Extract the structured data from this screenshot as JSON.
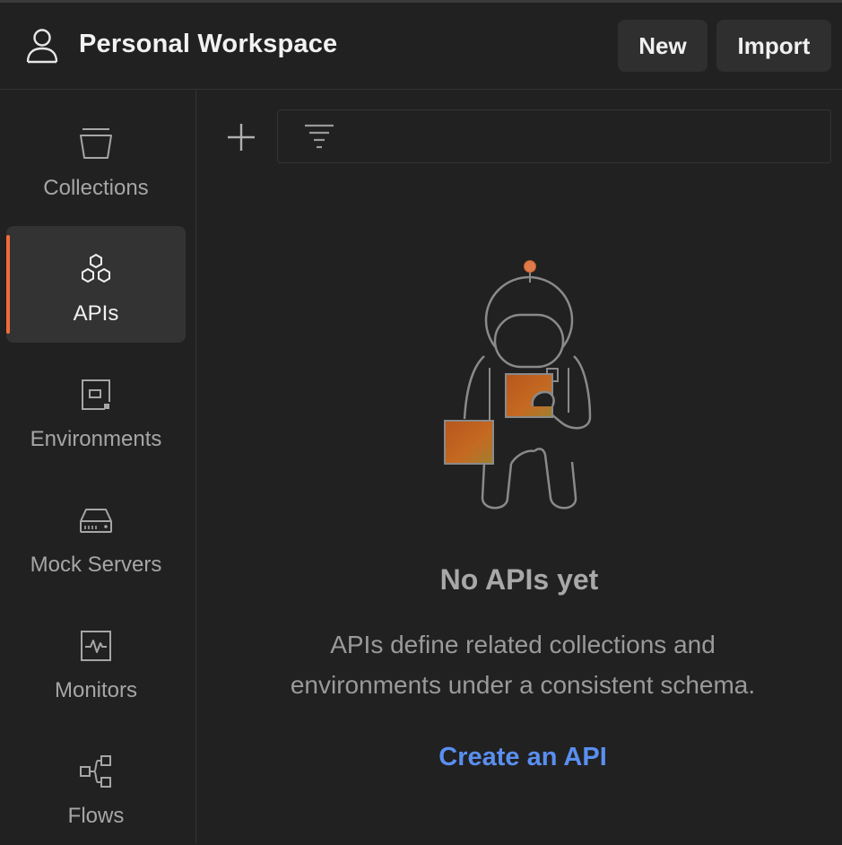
{
  "header": {
    "workspace_title": "Personal Workspace",
    "new_label": "New",
    "import_label": "Import"
  },
  "sidebar": {
    "items": [
      {
        "label": "Collections",
        "icon": "collections-icon",
        "active": false
      },
      {
        "label": "APIs",
        "icon": "apis-icon",
        "active": true
      },
      {
        "label": "Environments",
        "icon": "environments-icon",
        "active": false
      },
      {
        "label": "Mock Servers",
        "icon": "mock-servers-icon",
        "active": false
      },
      {
        "label": "Monitors",
        "icon": "monitors-icon",
        "active": false
      },
      {
        "label": "Flows",
        "icon": "flows-icon",
        "active": false
      }
    ]
  },
  "empty_state": {
    "title": "No APIs yet",
    "description_line1": "APIs define related collections and",
    "description_line2": "environments under a consistent schema.",
    "action_label": "Create an API"
  },
  "colors": {
    "background": "#212121",
    "accent": "#f26b3a",
    "link": "#5a8ff0"
  }
}
